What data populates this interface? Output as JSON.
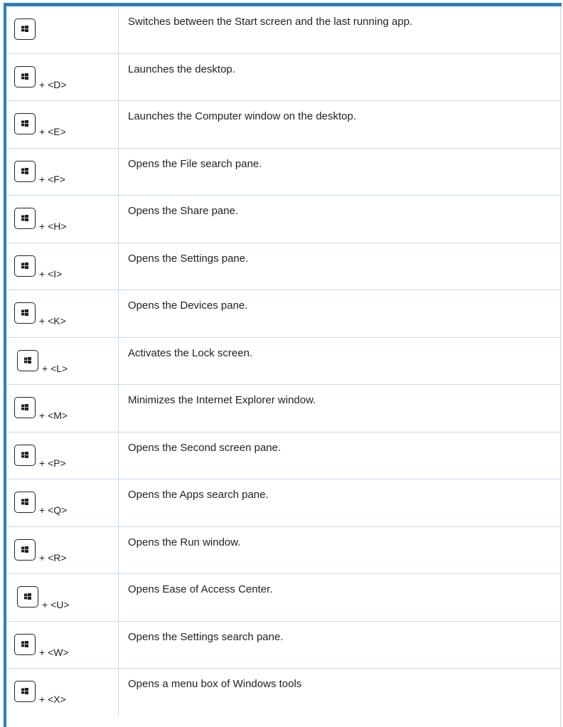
{
  "colors": {
    "accent_bar": "#2a7fc1",
    "grid_line": "#c8daea",
    "text": "#231f20"
  },
  "key_icon": "windows-logo-key-icon",
  "shortcuts": [
    {
      "combo": "",
      "description": "Switches between the Start screen and the last running app."
    },
    {
      "combo": "+ <D>",
      "description": "Launches the desktop."
    },
    {
      "combo": "+ <E>",
      "description": "Launches the Computer window on the desktop."
    },
    {
      "combo": "+ <F>",
      "description": "Opens the File search pane."
    },
    {
      "combo": "+ <H>",
      "description": "Opens the Share pane."
    },
    {
      "combo": "+ <I>",
      "description": "Opens the Settings pane."
    },
    {
      "combo": "+ <K>",
      "description": "Opens the Devices pane."
    },
    {
      "combo": "+ <L>",
      "description": "Activates the Lock screen."
    },
    {
      "combo": "+ <M>",
      "description": "Minimizes the Internet Explorer window."
    },
    {
      "combo": "+ <P>",
      "description": "Opens the Second screen pane."
    },
    {
      "combo": "+ <Q>",
      "description": "Opens the Apps search pane."
    },
    {
      "combo": "+ <R>",
      "description": "Opens the Run window."
    },
    {
      "combo": "+ <U>",
      "description": "Opens Ease of Access Center."
    },
    {
      "combo": "+ <W>",
      "description": "Opens the Settings search pane."
    },
    {
      "combo": "+ <X>",
      "description": "Opens a menu box of Windows tools"
    }
  ]
}
